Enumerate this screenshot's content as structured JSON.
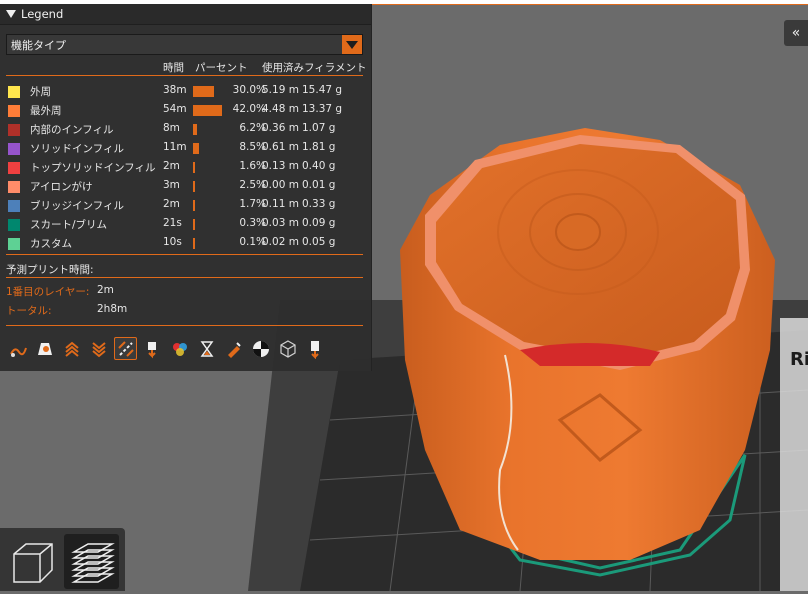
{
  "legend": {
    "title": "Legend",
    "view_type": "機能タイプ",
    "columns": {
      "time": "時間",
      "percent": "パーセント",
      "filament": "使用済みフィラメント"
    },
    "rows": [
      {
        "label": "外周",
        "color": "#ffe64d",
        "time": "38m",
        "percent": "30.0%",
        "length": "5.19 m",
        "weight": "15.47 g",
        "bar": 0.3
      },
      {
        "label": "最外周",
        "color": "#ff7d38",
        "time": "54m",
        "percent": "42.0%",
        "length": "4.48 m",
        "weight": "13.37 g",
        "bar": 0.42
      },
      {
        "label": "内部のインフィル",
        "color": "#b03029",
        "time": "8m",
        "percent": "6.2%",
        "length": "0.36 m",
        "weight": "1.07 g",
        "bar": 0.062
      },
      {
        "label": "ソリッドインフィル",
        "color": "#9654cc",
        "time": "11m",
        "percent": "8.5%",
        "length": "0.61 m",
        "weight": "1.81 g",
        "bar": 0.085
      },
      {
        "label": "トップソリッドインフィル",
        "color": "#f04040",
        "time": "2m",
        "percent": "1.6%",
        "length": "0.13 m",
        "weight": "0.40 g",
        "bar": 0.016
      },
      {
        "label": "アイロンがけ",
        "color": "#ff8c69",
        "time": "3m",
        "percent": "2.5%",
        "length": "0.00 m",
        "weight": "0.01 g",
        "bar": 0.025
      },
      {
        "label": "ブリッジインフィル",
        "color": "#4d80ba",
        "time": "2m",
        "percent": "1.7%",
        "length": "0.11 m",
        "weight": "0.33 g",
        "bar": 0.017
      },
      {
        "label": "スカート/ブリム",
        "color": "#00876e",
        "time": "21s",
        "percent": "0.3%",
        "length": "0.03 m",
        "weight": "0.09 g",
        "bar": 0.003
      },
      {
        "label": "カスタム",
        "color": "#5ed194",
        "time": "10s",
        "percent": "0.1%",
        "length": "0.02 m",
        "weight": "0.05 g",
        "bar": 0.001
      }
    ],
    "estimate": {
      "title": "予測プリント時間:",
      "first_layer_label": "1番目のレイヤー:",
      "first_layer_value": "2m",
      "total_label": "トータル:",
      "total_value": "2h8m"
    },
    "toolbar_icons": [
      "travel-icon",
      "wipe-icon",
      "retractions-icon",
      "deretractions-icon",
      "seams-icon",
      "tool-changes-icon",
      "color-changes-icon",
      "pause-prints-icon",
      "custom-gcodes-icon",
      "center-of-gravity-icon",
      "shells-icon",
      "tool-marker-icon"
    ],
    "accent_color": "#e06a1a"
  },
  "viewport": {
    "bed_label": "Ri"
  }
}
